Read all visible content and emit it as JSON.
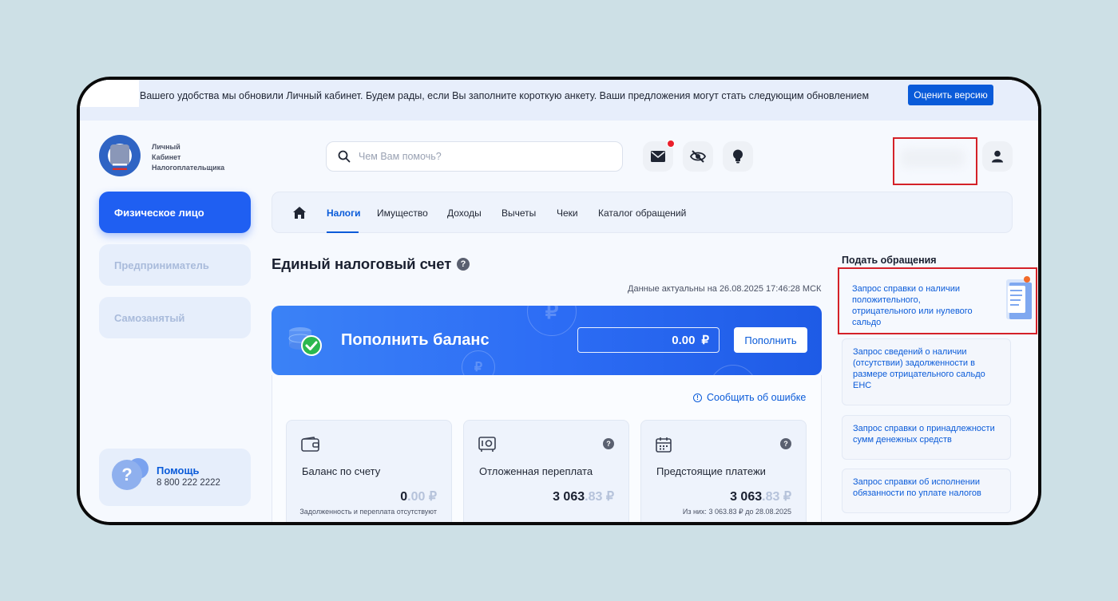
{
  "banner": {
    "text": "Вашего удобства мы обновили Личный кабинет. Будем рады, если Вы заполните короткую анкету. Ваши предложения могут стать следующим обновлением",
    "button": "Оценить версию"
  },
  "brand": {
    "line1": "Личный",
    "line2": "Кабинет",
    "line3": "Налогоплательщика"
  },
  "search": {
    "placeholder": "Чем Вам помочь?"
  },
  "sidebar": {
    "items": [
      {
        "label": "Физическое лицо",
        "active": true
      },
      {
        "label": "Предприниматель",
        "active": false
      },
      {
        "label": "Самозанятый",
        "active": false
      }
    ],
    "help": {
      "title": "Помощь",
      "phone": "8 800 222 2222"
    }
  },
  "nav": {
    "tabs": [
      {
        "label": "Налоги",
        "active": true
      },
      {
        "label": "Имущество"
      },
      {
        "label": "Доходы"
      },
      {
        "label": "Вычеты"
      },
      {
        "label": "Чеки"
      },
      {
        "label": "Каталог обращений"
      }
    ]
  },
  "main": {
    "title": "Единый налоговый счет",
    "data_date": "Данные актуальны на 26.08.2025 17:46:28 МСК",
    "topup": {
      "title": "Пополнить баланс",
      "amount": "0.00",
      "currency": "₽",
      "button": "Пополнить"
    },
    "report_link": "Сообщить об ошибке",
    "cards": [
      {
        "label": "Баланс по счету",
        "amount_int": "0",
        "amount_frac": ".00 ₽",
        "note": "Задолженность и переплата отсутствуют",
        "icon": "wallet-icon"
      },
      {
        "label": "Отложенная переплата",
        "amount_int": "3 063",
        "amount_frac": ".83 ₽",
        "note": "",
        "icon": "safe-icon"
      },
      {
        "label": "Предстоящие платежи",
        "amount_int": "3 063",
        "amount_frac": ".83 ₽",
        "note": "Из них: 3 063.83 ₽ до 28.08.2025",
        "icon": "calendar-icon"
      }
    ]
  },
  "appeals": {
    "title": "Подать обращения",
    "items": [
      "Запрос справки о наличии положительного, отрицательного или нулевого сальдо",
      "Запрос сведений о наличии (отсутствии) задолженности в размере отрицательного сальдо ЕНС",
      "Запрос справки о принадлежности сумм денежных средств",
      "Запрос справки об исполнении обязанности по уплате налогов"
    ]
  },
  "colors": {
    "accent": "#0a5bd9",
    "active_sidebar": "#1f5ff2",
    "notification": "#ea1f2c",
    "highlight": "#d42128"
  }
}
